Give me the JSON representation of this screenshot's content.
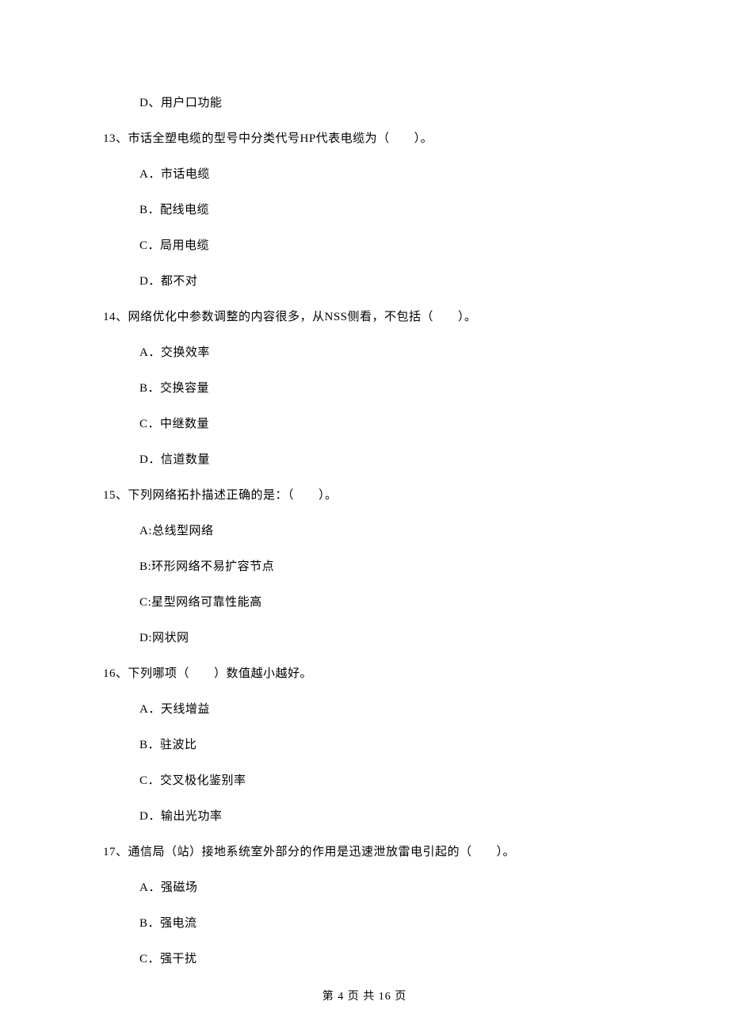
{
  "prev_q_option_d": "D、用户口功能",
  "questions": [
    {
      "stem": "13、市话全塑电缆的型号中分类代号HP代表电缆为（　　）。",
      "options": [
        "A．市话电缆",
        "B．配线电缆",
        "C．局用电缆",
        "D．都不对"
      ]
    },
    {
      "stem": "14、网络优化中参数调整的内容很多，从NSS侧看，不包括（　　）。",
      "options": [
        "A．交换效率",
        "B．交换容量",
        "C．中继数量",
        "D．信道数量"
      ]
    },
    {
      "stem": "15、下列网络拓扑描述正确的是：（　　）。",
      "options": [
        "A:总线型网络",
        "B:环形网络不易扩容节点",
        "C:星型网络可靠性能高",
        "D:网状网"
      ]
    },
    {
      "stem": "16、下列哪项（　　）数值越小越好。",
      "options": [
        "A．天线增益",
        "B．驻波比",
        "C．交叉极化鉴别率",
        "D．输出光功率"
      ]
    },
    {
      "stem": "17、通信局（站）接地系统室外部分的作用是迅速泄放雷电引起的（　　）。",
      "options": [
        "A．强磁场",
        "B．强电流",
        "C．强干扰"
      ]
    }
  ],
  "footer": "第 4 页 共 16 页"
}
